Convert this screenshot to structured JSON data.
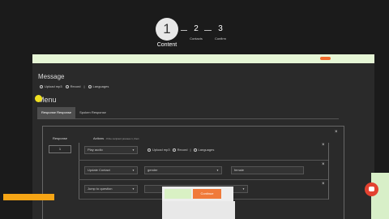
{
  "stepper": {
    "steps": [
      {
        "num": "1",
        "label": "Content"
      },
      {
        "num": "2",
        "label": "Contacts"
      },
      {
        "num": "3",
        "label": "Confirm"
      }
    ]
  },
  "message": {
    "title": "Message",
    "options": [
      "Upload mp3",
      "Record",
      "|",
      "Languages"
    ]
  },
  "menu": {
    "title": "Menu",
    "tabs": [
      "Response Response",
      "Spoken Response"
    ]
  },
  "table": {
    "response_header": "Response",
    "actions_header": "Actions",
    "actions_sub": "- If the recipient presses 1, then:",
    "response_value": "1",
    "rows": [
      {
        "action": "Play audio",
        "options": [
          "Upload mp3",
          "Record",
          "|",
          "Languages"
        ]
      },
      {
        "action": "Update Contact",
        "field": "gender",
        "value": "female"
      },
      {
        "action": "Jump to question"
      }
    ],
    "close": "×"
  },
  "footer": {
    "continue_label": "Continue"
  },
  "colors": {
    "accent": "#f07a3a",
    "save": "#f6a515",
    "chat": "#e34230"
  }
}
